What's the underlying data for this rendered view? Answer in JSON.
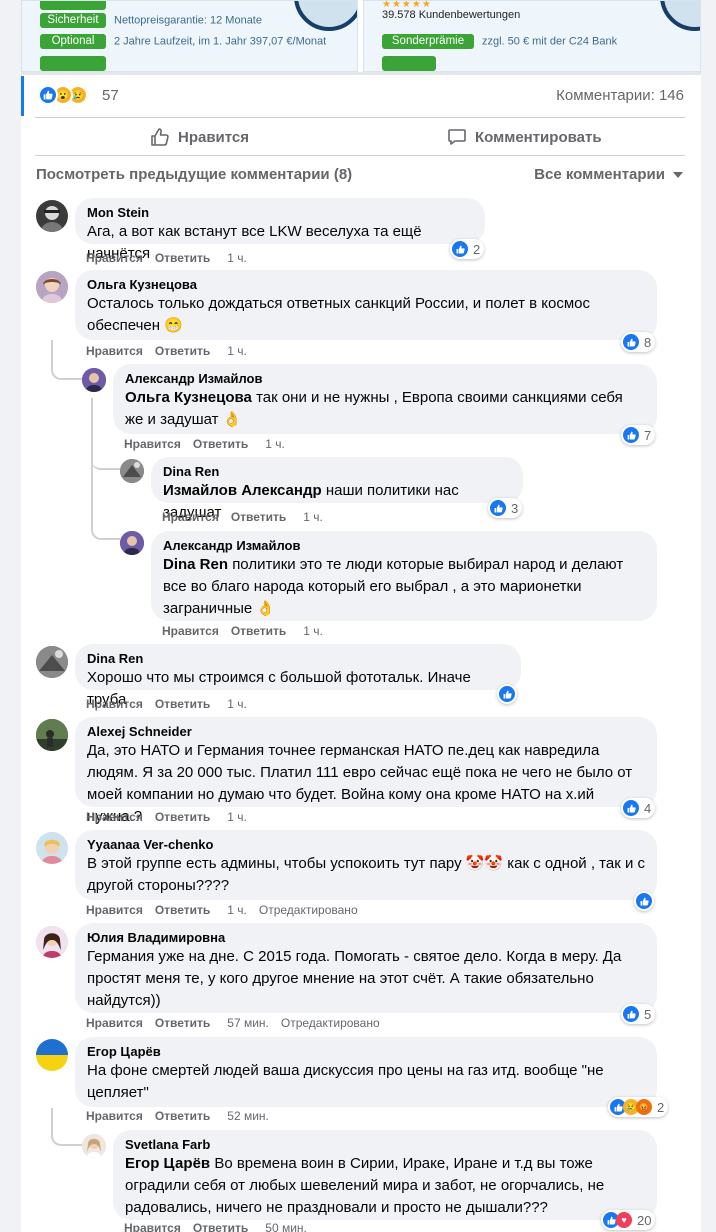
{
  "ad": {
    "left": {
      "rows": [
        {
          "pill": "Sicherheit",
          "text": "Nettopreisgarantie: 12 Monate"
        },
        {
          "pill": "Optional",
          "text": "2 Jahre Laufzeit, im 1. Jahr 397,07 €/Monat"
        }
      ]
    },
    "right": {
      "count": "39.578 Kundenbewertungen",
      "row": {
        "pill": "Sonderprämie",
        "text": "zzgl. 50 € mit der C24 Bank"
      }
    }
  },
  "reactions": {
    "count": "57",
    "comments_count": "Комментарии: 146"
  },
  "actions": {
    "like": "Нравится",
    "comment": "Комментировать"
  },
  "filters": {
    "previous": "Посмотреть предыдущие комментарии (8)",
    "all": "Все комментарии"
  },
  "labels": {
    "like": "Нравится",
    "reply": "Ответить"
  },
  "comments": [
    {
      "author": "Mon Stein",
      "text": "Ага, а вот как встанут все LKW веселуха та ещё начнётся",
      "time": "1 ч.",
      "reactions": "2"
    },
    {
      "author": "Ольга Кузнецова",
      "text": "Осталось только дождаться ответных санкций России, и полет в космос обеспечен 😁",
      "time": "1 ч.",
      "reactions": "8"
    },
    {
      "author": "Александр Измайлов",
      "mention": "Ольга Кузнецова",
      "text": "так они и не нужны , Европа своими санкциями себя же и задушат 👌",
      "time": "1 ч.",
      "reactions": "7"
    },
    {
      "author": "Dina Ren",
      "mention": "Измайлов Александр",
      "text": "наши политики нас задушат",
      "time": "1 ч.",
      "reactions": "3"
    },
    {
      "author": "Александр Измайлов",
      "mention": "Dina Ren",
      "text": "политики это те люди которые выбирал народ и делают все во благо народа который его выбрал , а это марионетки заграничные 👌",
      "time": "1 ч."
    },
    {
      "author": "Dina Ren",
      "text": "Хорошо что мы строимся с большой фототальк. Иначе труба",
      "time": "1 ч."
    },
    {
      "author": "Alexej Schneider",
      "text": "Да, это НАТО и Германия точнее германская НАТО пе.дец как навредила людям. Я за 20 000 тыс. Платил 111 евро сейчас ещё пока не чего не было от моей компании но думаю что будет. Война кому она кроме НАТО на х.ий нужна.?",
      "time": "1 ч.",
      "reactions": "4"
    },
    {
      "author": "Yyaanaa Ver-chenko",
      "text": "В этой группе есть админы, чтобы успокоить тут пару 🤡🤡 как с одной , так и с другой стороны????",
      "time": "1 ч.",
      "edited": "Отредактировано"
    },
    {
      "author": "Юлия Владимировна",
      "text": "Германия уже на дне. С 2015 года. Помогать - святое дело. Когда в меру. Да простят меня те, у кого другое мнение на этот счёт. А такие обязательно найдутся))",
      "time": "57 мин.",
      "edited": "Отредактировано",
      "reactions": "5"
    },
    {
      "author": "Егор Царёв",
      "text": "На фоне смертей людей ваша дискуссия про цены на газ итд. вообще \"не цепляет\"",
      "time": "52 мин.",
      "reactions": "2"
    },
    {
      "author": "Svetlana Farb",
      "mention": "Егор Царёв",
      "text": "Во времена воин в Сирии, Ираке, Иране и т.д вы тоже оградили себя от любых шевелений мира и забот, не огорчались, не радовались, ничего не праздновали и просто не дышали???",
      "time": "50 мин.",
      "reactions": "20"
    }
  ]
}
